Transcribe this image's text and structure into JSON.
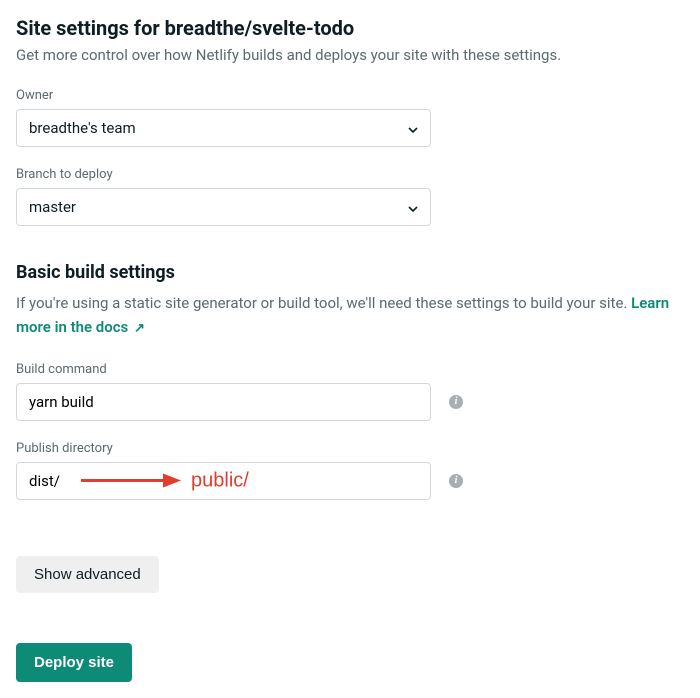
{
  "header": {
    "title": "Site settings for breadthe/svelte-todo",
    "subtitle": "Get more control over how Netlify builds and deploys your site with these settings."
  },
  "owner": {
    "label": "Owner",
    "value": "breadthe's team"
  },
  "branch": {
    "label": "Branch to deploy",
    "value": "master"
  },
  "build_section": {
    "heading": "Basic build settings",
    "description": "If you're using a static site generator or build tool, we'll need these settings to build your site. ",
    "link_text": "Learn more in the docs",
    "link_arrow": "↗"
  },
  "build_command": {
    "label": "Build command",
    "value": "yarn build"
  },
  "publish_dir": {
    "label": "Publish directory",
    "value": "dist/"
  },
  "annotation": {
    "text": "public/"
  },
  "buttons": {
    "advanced": "Show advanced",
    "deploy": "Deploy site"
  }
}
